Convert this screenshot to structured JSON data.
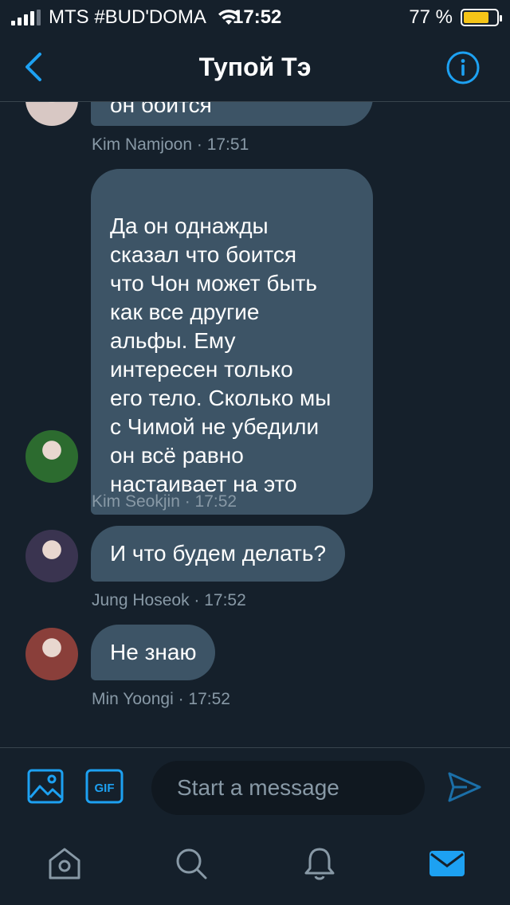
{
  "status_bar": {
    "carrier": "MTS #BUD'DOMA",
    "time": "17:52",
    "battery_text": "77 %",
    "battery_level": 0.77,
    "signal_bars": 4
  },
  "header": {
    "title": "Тупой Тэ"
  },
  "messages": [
    {
      "text": "он боится",
      "meta": "Kim Namjoon · 17:51",
      "avatar_color": "#d8c8c4"
    },
    {
      "text": "Да он однажды\nсказал что боится\nчто Чон может быть\nкак все другие\nальфы. Ему\nинтересен только\nего тело. Сколько мы\nс Чимой не убедили\nон всё равно\nнастаивает на это",
      "meta": "Kim Seokjin · 17:52",
      "avatar_color": "#2c6b2f"
    },
    {
      "text": "И что будем делать?",
      "meta": "Jung Hoseok · 17:52",
      "avatar_color": "#3a3450"
    },
    {
      "text": "Не знаю",
      "meta": "Min Yoongi · 17:52",
      "avatar_color": "#8a3f3a"
    }
  ],
  "composer": {
    "placeholder": "Start a message",
    "gif_label": "GIF"
  },
  "tabbar": {
    "items": [
      "home-icon",
      "search-icon",
      "bell-icon",
      "mail-icon"
    ],
    "active": "mail-icon"
  },
  "colors": {
    "background": "#15202b",
    "bubble": "#3d5466",
    "accent": "#1da1f2",
    "meta_text": "#8899a6"
  }
}
